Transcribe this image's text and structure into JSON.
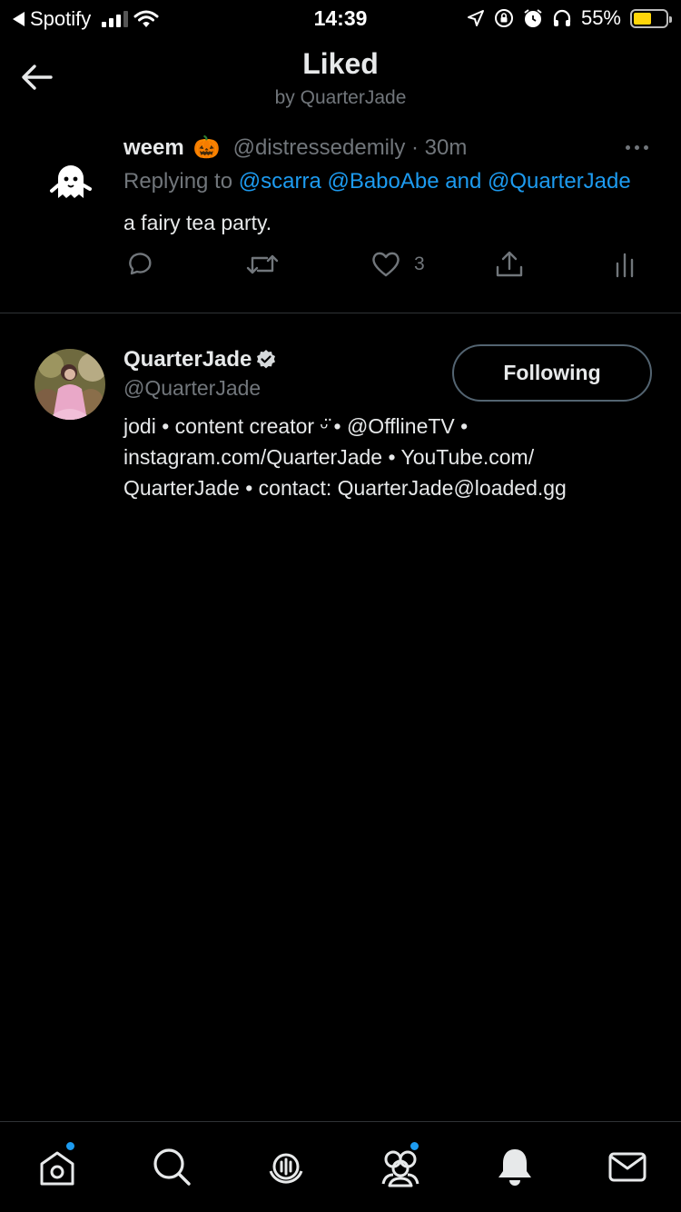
{
  "status_bar": {
    "back_app": "Spotify",
    "time": "14:39",
    "battery": "55%",
    "battery_level": 0.55
  },
  "header": {
    "title": "Liked",
    "subtitle": "by QuarterJade"
  },
  "tweet": {
    "display_name": "weem",
    "name_emoji": "🎃",
    "handle_time": "@distressedemily · 30m",
    "replying_prefix": "Replying to ",
    "replying_targets": "@scarra @BaboAbe and @QuarterJade",
    "text": "a fairy tea party.",
    "like_count": "3"
  },
  "profile": {
    "name": "QuarterJade",
    "handle": "@QuarterJade",
    "follow_label": "Following",
    "bio_lines": [
      "jodi • content creator ᵕ̈ • @OfflineTV •",
      "instagram.com/QuarterJade • YouTube.com/",
      "QuarterJade • contact: QuarterJade@loaded.gg"
    ]
  },
  "colors": {
    "accent": "#1d9bf0",
    "muted": "#71767b",
    "text": "#e7e9ea",
    "divider": "#2f3336",
    "battery": "#ffd60a"
  },
  "icons": {
    "nav": [
      "home-icon",
      "search-icon",
      "spaces-icon",
      "communities-icon",
      "notifications-icon",
      "messages-icon"
    ]
  }
}
